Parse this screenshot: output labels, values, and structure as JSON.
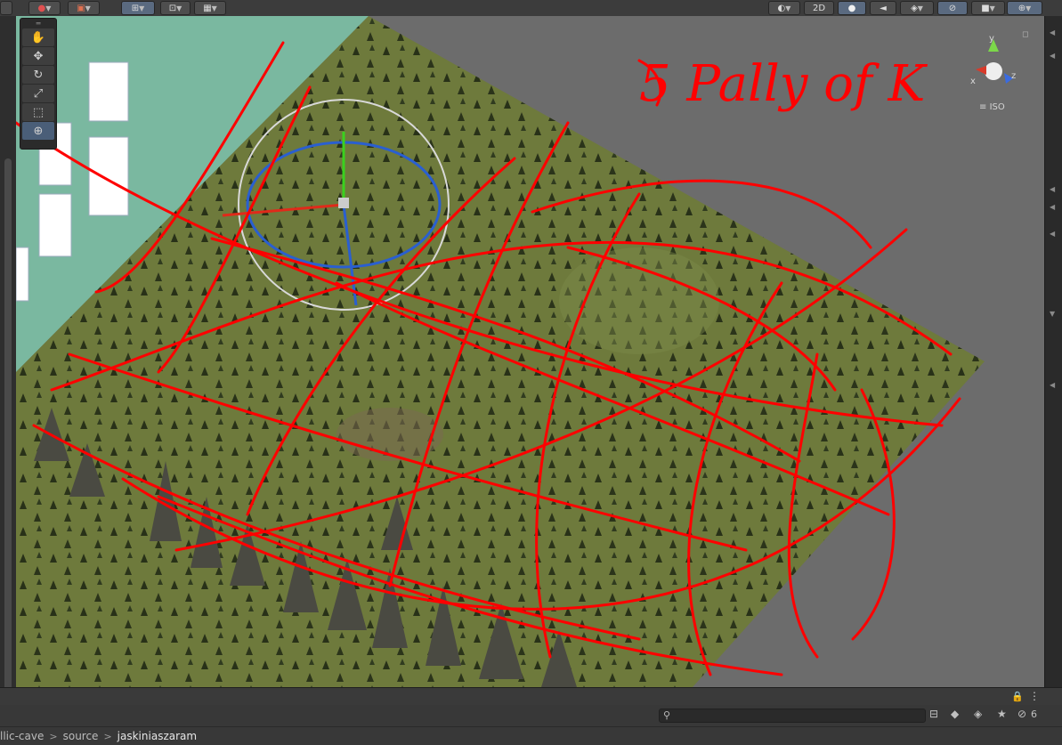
{
  "toolbar": {
    "buttons": [
      {
        "name": "draw-mode-button",
        "icon": "mode-icon",
        "label": "●"
      },
      {
        "name": "shading-button",
        "icon": "cube-icon",
        "label": "▣"
      },
      {
        "name": "grid-snap-button",
        "icon": "grid-icon",
        "label": "⊞"
      },
      {
        "name": "snap-increment-button",
        "icon": "snap-icon",
        "label": "⊡"
      },
      {
        "name": "grid-button",
        "icon": "grid-plane-icon",
        "label": "▦"
      }
    ],
    "right_buttons": [
      {
        "name": "view-options-button",
        "label": "◐"
      },
      {
        "name": "mode-2d-button",
        "label": "2D"
      },
      {
        "name": "lighting-button",
        "label": "💡"
      },
      {
        "name": "audio-button",
        "label": "🔇"
      },
      {
        "name": "effects-button",
        "label": "◈"
      },
      {
        "name": "hidden-objects-button",
        "label": "⊘"
      },
      {
        "name": "camera-button",
        "label": "▶"
      },
      {
        "name": "gizmos-button",
        "label": "⊕"
      }
    ]
  },
  "tools": [
    {
      "name": "hand-tool",
      "glyph": "✋",
      "active": false
    },
    {
      "name": "move-tool",
      "glyph": "✥",
      "active": false
    },
    {
      "name": "rotate-tool",
      "glyph": "↻",
      "active": false
    },
    {
      "name": "scale-tool",
      "glyph": "⤢",
      "active": false
    },
    {
      "name": "rect-tool",
      "glyph": "⬚",
      "active": false
    },
    {
      "name": "transform-tool",
      "glyph": "⊕",
      "active": true
    }
  ],
  "scene_gizmo": {
    "x_label": "x",
    "y_label": "y",
    "z_label": "z",
    "projection": "ISO"
  },
  "annotation": {
    "handwritten_text": "5 Pally of K",
    "color": "#ff0000"
  },
  "project": {
    "search_placeholder": "",
    "hidden_count": "6"
  },
  "breadcrumb": {
    "items": [
      "llic-cave",
      "source",
      "jaskiniaszaram"
    ]
  },
  "colors": {
    "terrain": "#6f7a3d",
    "ground": "#6c6c6c",
    "water": "#7cb8a0",
    "annotation": "#ff0000"
  }
}
